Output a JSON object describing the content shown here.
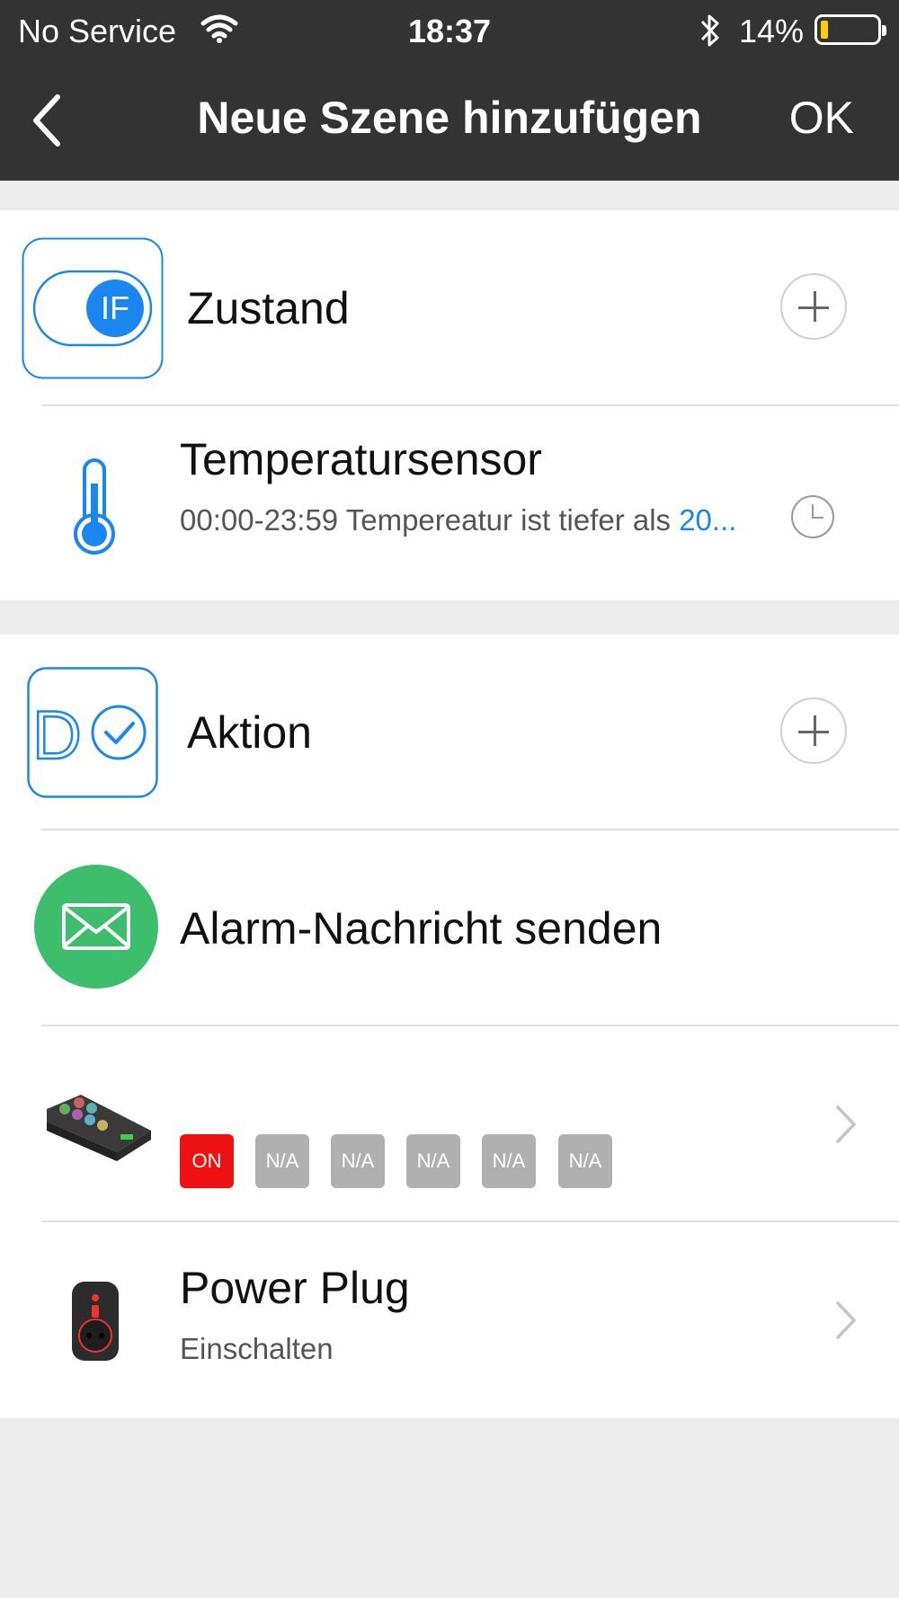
{
  "status_bar": {
    "carrier": "No Service",
    "time": "18:37",
    "battery_percent": "14%",
    "battery_level": 0.14,
    "battery_color": "#ffcc00"
  },
  "nav": {
    "title": "Neue Szene hinzufügen",
    "ok_label": "OK"
  },
  "condition": {
    "header_label": "Zustand",
    "if_badge": "IF",
    "items": [
      {
        "title": "Temperatursensor",
        "subtitle": "00:00-23:59 Tempereatur ist tiefer als ",
        "subtitle_value": "20..."
      }
    ]
  },
  "action": {
    "header_label": "Aktion",
    "do_badge": "D",
    "items": [
      {
        "title": "Alarm-Nachricht senden"
      },
      {
        "chips": [
          "ON",
          "N/A",
          "N/A",
          "N/A",
          "N/A",
          "N/A"
        ]
      },
      {
        "title": "Power Plug",
        "subtitle": "Einschalten"
      }
    ]
  },
  "colors": {
    "accent": "#1a86f0",
    "nav_bg": "#333333",
    "mail_green": "#3dbe6c",
    "on_red": "#ee1111",
    "na_gray": "#b0b0b0"
  }
}
